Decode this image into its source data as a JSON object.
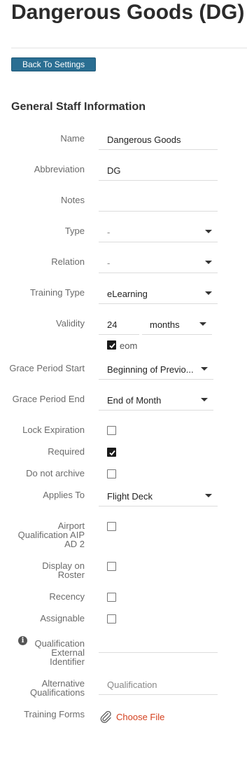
{
  "page": {
    "title": "Dangerous Goods (DG)"
  },
  "buttons": {
    "back": "Back To Settings"
  },
  "section": {
    "title": "General Staff Information"
  },
  "form": {
    "name": {
      "label": "Name",
      "value": "Dangerous Goods"
    },
    "abbreviation": {
      "label": "Abbreviation",
      "value": "DG"
    },
    "notes": {
      "label": "Notes",
      "value": ""
    },
    "type": {
      "label": "Type",
      "value": "-"
    },
    "relation": {
      "label": "Relation",
      "value": "-"
    },
    "training_type": {
      "label": "Training Type",
      "value": "eLearning"
    },
    "validity": {
      "label": "Validity",
      "number": "24",
      "unit": "months",
      "eom_label": "eom",
      "eom_checked": true
    },
    "grace_period_start": {
      "label": "Grace Period Start",
      "value": "Beginning of Previo..."
    },
    "grace_period_end": {
      "label": "Grace Period End",
      "value": "End of Month"
    },
    "lock_expiration": {
      "label": "Lock Expiration",
      "checked": false
    },
    "required": {
      "label": "Required",
      "checked": true
    },
    "do_not_archive": {
      "label": "Do not archive",
      "checked": false
    },
    "applies_to": {
      "label": "Applies To",
      "value": "Flight Deck"
    },
    "airport_qualification": {
      "label": "Airport Qualification AIP AD 2",
      "checked": false
    },
    "display_on_roster": {
      "label": "Display on Roster",
      "checked": false
    },
    "recency": {
      "label": "Recency",
      "checked": false
    },
    "assignable": {
      "label": "Assignable",
      "checked": false
    },
    "external_identifier": {
      "label": "Qualification External Identifier",
      "value": ""
    },
    "alternative_qualifications": {
      "label": "Alternative Qualifications",
      "placeholder": "Qualification"
    },
    "training_forms": {
      "label": "Training Forms",
      "action": "Choose File"
    }
  },
  "icons": {
    "info": "info-icon",
    "attachment": "paperclip-icon",
    "dropdown": "caret-down-icon",
    "check": "checkmark-icon"
  },
  "colors": {
    "button": "#2a6e92",
    "link": "#d4401e",
    "title": "#2b2b2b"
  }
}
